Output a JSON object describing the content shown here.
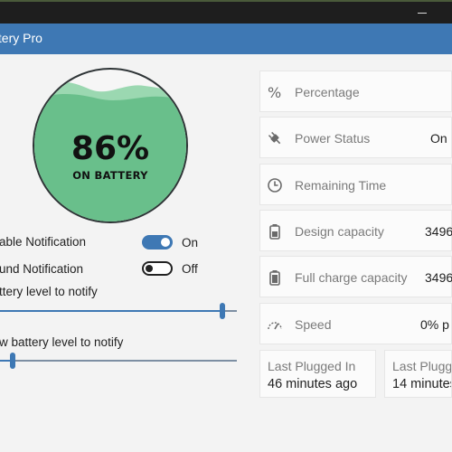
{
  "window": {
    "title": "ttery Pro"
  },
  "gauge": {
    "level": 0.86,
    "percent_text": "86%",
    "state_text": "ON BATTERY",
    "fill_color": "#69bf8b",
    "wave_color": "#9bd8b1"
  },
  "settings": {
    "enable_notification": {
      "label": "able Notification",
      "state": "On",
      "on": true
    },
    "sound_notification": {
      "label": "und Notification",
      "state": "Off",
      "on": false
    },
    "high_level_label": "ttery level to notify",
    "low_level_label": "w battery level to notify"
  },
  "cards": {
    "percentage": {
      "name": "Percentage",
      "icon": "percent-icon"
    },
    "power_status": {
      "name": "Power Status",
      "value": "On",
      "icon": "plug-icon"
    },
    "remaining_time": {
      "name": "Remaining Time",
      "icon": "clock-icon"
    },
    "design_capacity": {
      "name": "Design capacity",
      "value": "3496",
      "icon": "battery-icon"
    },
    "full_charge_capacity": {
      "name": "Full charge capacity",
      "value": "3496",
      "icon": "battery-full-icon"
    },
    "speed": {
      "name": "Speed",
      "value": "0% p",
      "icon": "speedometer-icon"
    },
    "last_plugged_in": {
      "caption": "Last Plugged In",
      "value": "46 minutes ago"
    },
    "last_plugged_partial": {
      "caption": "Last Plugge",
      "value": "14 minutes"
    }
  },
  "colors": {
    "accent": "#3e78b4",
    "gauge_green": "#69bf8b"
  }
}
